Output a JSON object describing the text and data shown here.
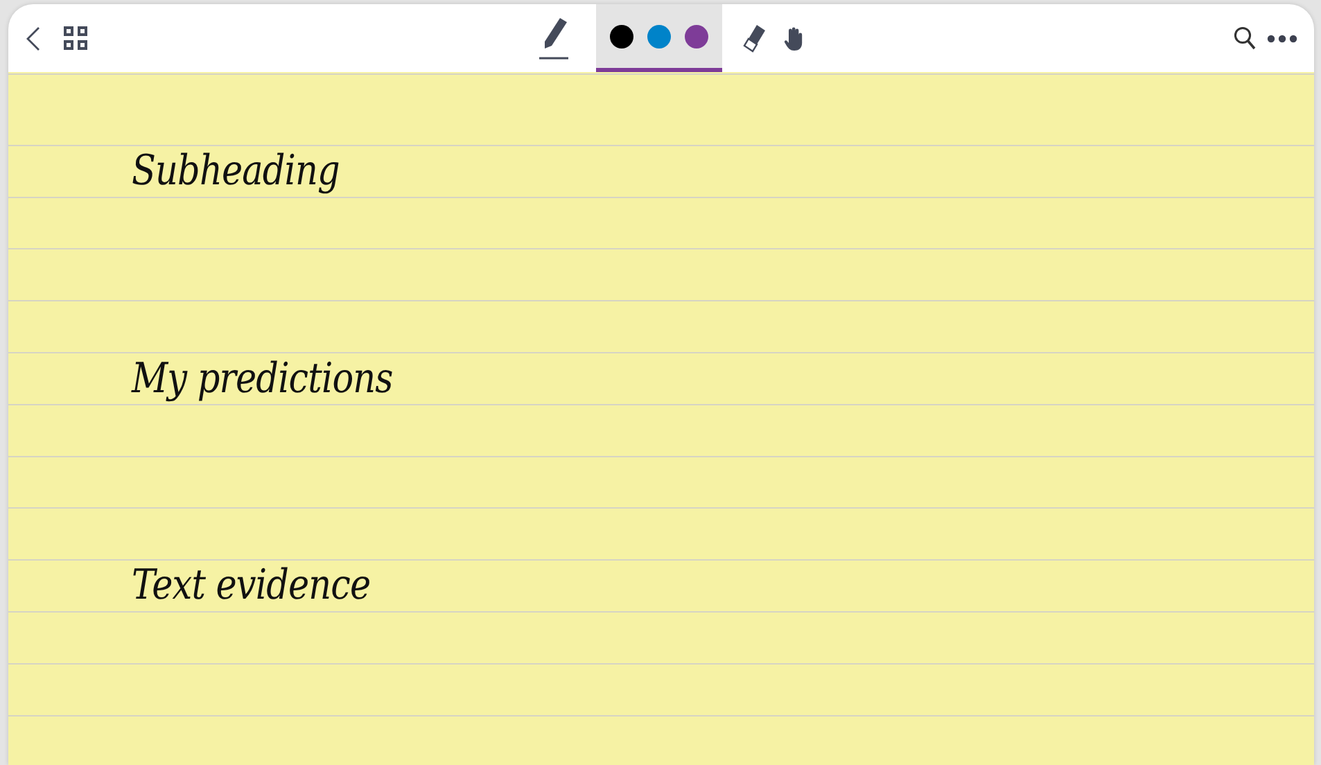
{
  "toolbar": {
    "tools": [
      {
        "kind": "pen"
      },
      {
        "kind": "palette",
        "selected": true,
        "color": "#7e3c98"
      },
      {
        "kind": "eraser"
      },
      {
        "kind": "hand"
      }
    ],
    "colors": [
      {
        "color": "#000000"
      },
      {
        "color": "#0083c9"
      },
      {
        "color": "#7e3c98"
      }
    ]
  },
  "headings": [
    "Subheading",
    "My predictions",
    "Text evidence"
  ]
}
